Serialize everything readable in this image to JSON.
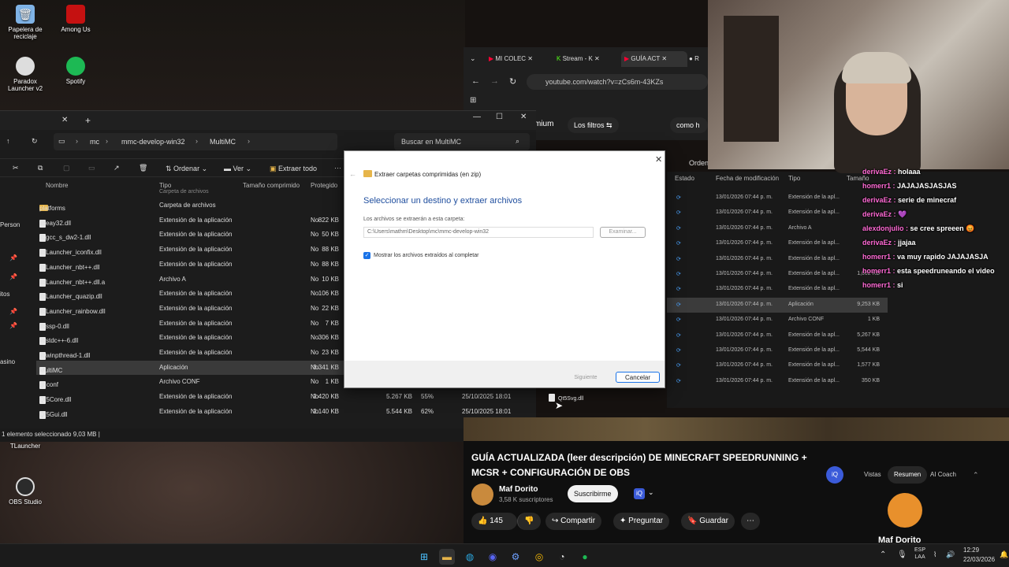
{
  "desktop": {
    "icons": [
      {
        "label": "Papelera de\nreciclaje",
        "icon": "recycle-bin-icon"
      },
      {
        "label": "Among Us",
        "icon": "among-us-icon"
      },
      {
        "label": "Paradox\nLauncher v2",
        "icon": "paradox-icon"
      },
      {
        "label": "Spotify",
        "icon": "spotify-icon"
      },
      {
        "label": "TLauncher",
        "icon": "tlauncher-icon"
      },
      {
        "label": "OBS Studio",
        "icon": "obs-icon"
      }
    ]
  },
  "explorer": {
    "new_tab": "+",
    "breadcrumb": [
      "mc",
      "mmc-develop-win32",
      "MultiMC"
    ],
    "search_placeholder": "Buscar en MultiMC",
    "toolbar": {
      "sort": "Ordenar",
      "view": "Ver",
      "extract_all": "Extraer todo",
      "more": "···"
    },
    "columns": {
      "name": "Nombre",
      "type": "Tipo",
      "compressed": "Tamaño comprimido",
      "protected": "Protegido"
    },
    "side_labels": [
      "Person",
      "itos",
      "asino"
    ],
    "partial_top_row": "Carpeta de archivos",
    "files": [
      {
        "name": "platforms",
        "type": "Carpeta de archivos",
        "size": "",
        "prot": "",
        "folder": true
      },
      {
        "name": "libeay32.dll",
        "type": "Extensión de la aplicación",
        "size": "822 KB",
        "prot": "No"
      },
      {
        "name": "libgcc_s_dw2-1.dll",
        "type": "Extensión de la aplicación",
        "size": "50 KB",
        "prot": "No"
      },
      {
        "name": "libLauncher_iconfix.dll",
        "type": "Extensión de la aplicación",
        "size": "88 KB",
        "prot": "No"
      },
      {
        "name": "libLauncher_nbt++.dll",
        "type": "Extensión de la aplicación",
        "size": "88 KB",
        "prot": "No"
      },
      {
        "name": "libLauncher_nbt++.dll.a",
        "type": "Archivo A",
        "size": "10 KB",
        "prot": "No"
      },
      {
        "name": "libLauncher_quazip.dll",
        "type": "Extensión de la aplicación",
        "size": "106 KB",
        "prot": "No"
      },
      {
        "name": "libLauncher_rainbow.dll",
        "type": "Extensión de la aplicación",
        "size": "22 KB",
        "prot": "No"
      },
      {
        "name": "libssp-0.dll",
        "type": "Extensión de la aplicación",
        "size": "7 KB",
        "prot": "No"
      },
      {
        "name": "libstdc++-6.dll",
        "type": "Extensión de la aplicación",
        "size": "306 KB",
        "prot": "No"
      },
      {
        "name": "libwinpthread-1.dll",
        "type": "Extensión de la aplicación",
        "size": "23 KB",
        "prot": "No"
      },
      {
        "name": "MultiMC",
        "type": "Aplicación",
        "size": "3.341 KB",
        "prot": "No",
        "selected": true
      },
      {
        "name": "qt.conf",
        "type": "Archivo CONF",
        "size": "1 KB",
        "prot": "No"
      },
      {
        "name": "Qt5Core.dll",
        "type": "Extensión de la aplicación",
        "size": "2.420 KB",
        "prot": "No",
        "extra": [
          "5.267 KB",
          "55%",
          "25/10/2025 18:01"
        ]
      },
      {
        "name": "Qt5Gui.dll",
        "type": "Extensión de la aplicación",
        "size": "2.140 KB",
        "prot": "No",
        "extra": [
          "5.544 KB",
          "62%",
          "25/10/2025 18:01"
        ]
      }
    ],
    "status": "1 elemento seleccionado  9,03 MB  |"
  },
  "dialog": {
    "header": "Extraer carpetas comprimidas (en zip)",
    "heading": "Seleccionar un destino y extraer archivos",
    "dest_label": "Los archivos se extraerán a esta carpeta:",
    "dest_value": "C:\\Users\\mathm\\Desktop\\mc\\mmc-develop-win32",
    "browse": "Examinar...",
    "checkbox": "Mostrar los archivos extraídos al completar",
    "next": "Siguiente",
    "cancel": "Cancelar"
  },
  "browser": {
    "tabs": [
      "MI COLEC",
      "Stream - K",
      "GUÍA ACT",
      "R"
    ],
    "url": "youtube.com/watch?v=zCs6m-43KZs",
    "chips": [
      "mium",
      "Los filtros",
      "como h"
    ]
  },
  "right_list": {
    "sort": "Ordenar",
    "cols": [
      "Estado",
      "Fecha de modificación",
      "Tipo",
      "Tamaño"
    ],
    "rows": [
      {
        "date": "13/01/2026 07:44 p. m.",
        "type": "Extensión de la apl...",
        "size": ""
      },
      {
        "date": "13/01/2026 07:44 p. m.",
        "type": "Extensión de la apl...",
        "size": ""
      },
      {
        "date": "13/01/2026 07:44 p. m.",
        "type": "Archivo A",
        "size": ""
      },
      {
        "date": "13/01/2026 07:44 p. m.",
        "type": "Extensión de la apl...",
        "size": ""
      },
      {
        "date": "13/01/2026 07:44 p. m.",
        "type": "Extensión de la apl...",
        "size": ""
      },
      {
        "date": "13/01/2026 07:44 p. m.",
        "type": "Extensión de la apl...",
        "size": "1,002 KB"
      },
      {
        "date": "13/01/2026 07:44 p. m.",
        "type": "Extensión de la apl...",
        "size": ""
      },
      {
        "date": "13/01/2026 07:44 p. m.",
        "type": "Aplicación",
        "size": "9,253 KB",
        "selected": true
      },
      {
        "date": "13/01/2026 07:44 p. m.",
        "type": "Archivo CONF",
        "size": "1 KB"
      },
      {
        "date": "13/01/2026 07:44 p. m.",
        "type": "Extensión de la apl...",
        "size": "5,267 KB"
      },
      {
        "date": "13/01/2026 07:44 p. m.",
        "type": "Extensión de la apl...",
        "size": "5,544 KB"
      },
      {
        "date": "13/01/2026 07:44 p. m.",
        "type": "Extensión de la apl...",
        "size": "1,577 KB"
      },
      {
        "date": "13/01/2026 07:44 p. m.",
        "type": "Extensión de la apl...",
        "size": "350 KB"
      }
    ],
    "trailing_file": "Qt5Svg.dll"
  },
  "chat": [
    {
      "user": "derivaEz :",
      "msg": "holaaa"
    },
    {
      "user": "homerr1 :",
      "msg": "JAJAJASJASJAS"
    },
    {
      "user": "derivaEz :",
      "msg": "serie de minecraf"
    },
    {
      "user": "derivaEz :",
      "msg": "💜"
    },
    {
      "user": "alexdonjulio :",
      "msg": "se cree spreeen 😡"
    },
    {
      "user": "derivaEz :",
      "msg": "jjajaa"
    },
    {
      "user": "homerr1 :",
      "msg": "va muy rapido JAJAJASJA"
    },
    {
      "user": "homerr1 :",
      "msg": "esta speedruneando el video"
    },
    {
      "user": "homerr1 :",
      "msg": "si"
    }
  ],
  "youtube": {
    "title": "GUÍA ACTUALIZADA (leer descripción) DE MINECRAFT SPEEDRUNNING + MCSR + CONFIGURACIÓN DE OBS",
    "channel": "Maf Dorito",
    "subs": "3,58 K suscriptores",
    "subscribe": "Suscribirme",
    "likes": "145",
    "share": "Compartir",
    "ask": "Preguntar",
    "save": "Guardar",
    "side_tabs": [
      "Vistas",
      "Resumen",
      "AI Coach"
    ],
    "side_channel": "Maf Dorito"
  },
  "taskbar": {
    "lang": "ESP\nLAA",
    "time": "12:29",
    "date": "22/03/2026"
  },
  "colors": {
    "accent": "#1a73e8",
    "yt_red": "#ff0033",
    "chat_user": "#ff6ad5"
  }
}
